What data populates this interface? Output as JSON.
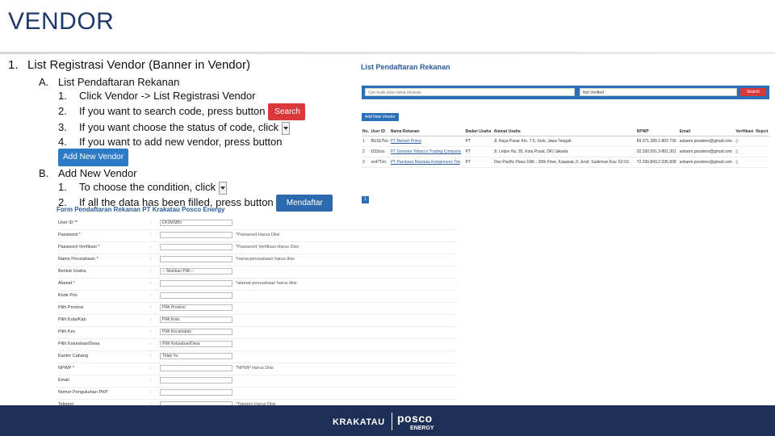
{
  "title": "VENDOR",
  "outline": {
    "h1_num": "1.",
    "h1_text": "List Registrasi Vendor (Banner in Vendor)",
    "A": {
      "letter": "A.",
      "text": "List Pendaftaran Rekanan",
      "steps": [
        {
          "n": "1.",
          "text": "Click Vendor -> List Registrasi Vendor"
        },
        {
          "n": "2.",
          "text": "If you want to search code, press button",
          "button": "Search"
        },
        {
          "n": "3.",
          "text": "If you want choose the status of code, click"
        },
        {
          "n": "4.",
          "text": "If you want to add new vendor, press button",
          "button": "Add New Vendor"
        }
      ]
    },
    "B": {
      "letter": "B.",
      "text": "Add New Vendor",
      "steps": [
        {
          "n": "1.",
          "text": "To choose the condition, click"
        },
        {
          "n": "2.",
          "text": "If all the data has been filled, press button",
          "button": "Mendaftar"
        }
      ]
    }
  },
  "list_screen": {
    "title": "List Pendaftaran Rekanan",
    "search_placeholder": "Cari kode atau nama rekanan",
    "status_value": "Not Verified",
    "search_button": "Search",
    "add_button": "Add New Vendor",
    "columns": [
      "No.",
      "User ID",
      "Nama Rekanan",
      "Badan Usaha",
      "Alamat Usaha",
      "NPWP",
      "Email",
      "Verifikasi",
      "Reject"
    ],
    "rows": [
      [
        "1",
        "BU1E7bo",
        "PT Bertoel Prima",
        "PT",
        "Jl. Raya Pasar Km. 7.5, Solo, Jawa Tengah",
        "89.371.389.1-802.730",
        "axbarm.posdeno@gmail.com",
        "",
        ""
      ],
      [
        "2",
        "fJ33cus",
        "PT Sumatra Tobacco Trading Company",
        "PT",
        "Jl. Letjen Ns. 35, Kota Pusat, DKI Jakarta",
        "02.330.091.3-801.301",
        "axbarm.posdeno@gmail.com",
        "",
        ""
      ],
      [
        "3",
        "sn47Tch",
        "PT Pandawa Mandala Komponens Tok",
        "PT",
        "One Pacific Place 16th - 20th Floor, Kawasat Jl. Jend. Sudirman Kav. 52-53.",
        "72.330.843.2-335.838",
        "axbarm.posdeno@gmail.com",
        "",
        ""
      ]
    ],
    "page": "1"
  },
  "form_screen": {
    "title": "Form Pendaftaran Rekanan PT Krakatau Posco Energy",
    "rows": [
      {
        "label": "User ID **",
        "value": "DF3MSBN",
        "hint": ""
      },
      {
        "label": "Password *",
        "value": "",
        "hint": "*Password Harus Diisi"
      },
      {
        "label": "Password Verifikasi *",
        "value": "",
        "hint": "*Password Verifikasi Harus Diisi"
      },
      {
        "label": "Nama Perusahaan *",
        "value": "",
        "hint": "*nama perusahaan harus diisi"
      },
      {
        "label": "Bentuk Usaha",
        "value": "-- Silahkan Pilih --",
        "hint": ""
      },
      {
        "label": "Alamat *",
        "value": "",
        "hint": "*alamat perusahaan harus diisi"
      },
      {
        "label": "Kode Pos",
        "value": "",
        "hint": ""
      },
      {
        "label": "Pilih Provinsi",
        "value": "Pilih Provinsi",
        "hint": ""
      },
      {
        "label": "Pilih Kota/Kab",
        "value": "Pilih Kota",
        "hint": ""
      },
      {
        "label": "Pilih Kec",
        "value": "Pilih Kecamatan",
        "hint": ""
      },
      {
        "label": "Pilih Kelurahan/Desa",
        "value": "Pilih Kelurahan/Desa",
        "hint": ""
      },
      {
        "label": "Kantor Cabang",
        "value": "Tidak  Ya",
        "hint": ""
      },
      {
        "label": "NPWP *",
        "value": "",
        "hint": "*NPWP Harus Diisi"
      },
      {
        "label": "Email",
        "value": "",
        "hint": ""
      },
      {
        "label": "Nomor Pengukuhan PKP",
        "value": "",
        "hint": ""
      },
      {
        "label": "Telepon",
        "value": "",
        "hint": "*Telepon Harus Diisi"
      }
    ]
  },
  "footer": {
    "brand1": "KRAKATAU",
    "brand2": "posco",
    "brand3": "ENERGY"
  },
  "colors": {
    "title": "#1f3a68",
    "footer": "#1d2f56",
    "primary_btn": "#2a6fb8",
    "search_btn": "#d9393a"
  }
}
